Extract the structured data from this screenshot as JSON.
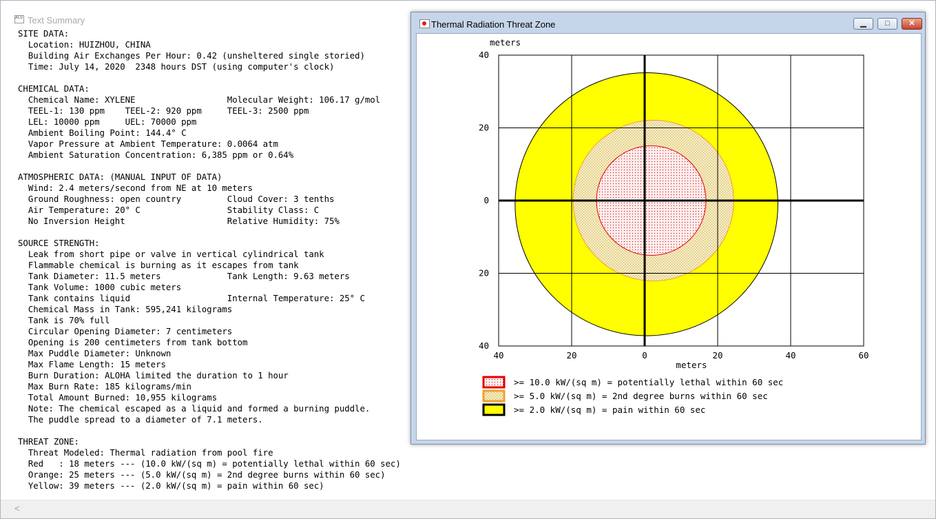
{
  "summary_window": {
    "title": "Text Summary",
    "lines": [
      "SITE DATA:",
      "  Location: HUIZHOU, CHINA",
      "  Building Air Exchanges Per Hour: 0.42 (unsheltered single storied)",
      "  Time: July 14, 2020  2348 hours DST (using computer's clock)",
      "",
      "CHEMICAL DATA:",
      "  Chemical Name: XYLENE                  Molecular Weight: 106.17 g/mol",
      "  TEEL-1: 130 ppm    TEEL-2: 920 ppm     TEEL-3: 2500 ppm",
      "  LEL: 10000 ppm     UEL: 70000 ppm",
      "  Ambient Boiling Point: 144.4° C",
      "  Vapor Pressure at Ambient Temperature: 0.0064 atm",
      "  Ambient Saturation Concentration: 6,385 ppm or 0.64%",
      "",
      "ATMOSPHERIC DATA: (MANUAL INPUT OF DATA)",
      "  Wind: 2.4 meters/second from NE at 10 meters",
      "  Ground Roughness: open country         Cloud Cover: 3 tenths",
      "  Air Temperature: 20° C                 Stability Class: C",
      "  No Inversion Height                    Relative Humidity: 75%",
      "",
      "SOURCE STRENGTH:",
      "  Leak from short pipe or valve in vertical cylindrical tank",
      "  Flammable chemical is burning as it escapes from tank",
      "  Tank Diameter: 11.5 meters             Tank Length: 9.63 meters",
      "  Tank Volume: 1000 cubic meters",
      "  Tank contains liquid                   Internal Temperature: 25° C",
      "  Chemical Mass in Tank: 595,241 kilograms",
      "  Tank is 70% full",
      "  Circular Opening Diameter: 7 centimeters",
      "  Opening is 200 centimeters from tank bottom",
      "  Max Puddle Diameter: Unknown",
      "  Max Flame Length: 15 meters",
      "  Burn Duration: ALOHA limited the duration to 1 hour",
      "  Max Burn Rate: 185 kilograms/min",
      "  Total Amount Burned: 10,955 kilograms",
      "  Note: The chemical escaped as a liquid and formed a burning puddle.",
      "  The puddle spread to a diameter of 7.1 meters.",
      "",
      "THREAT ZONE:",
      "  Threat Modeled: Thermal radiation from pool fire",
      "  Red   : 18 meters --- (10.0 kW/(sq m) = potentially lethal within 60 sec)",
      "  Orange: 25 meters --- (5.0 kW/(sq m) = 2nd degree burns within 60 sec)",
      "  Yellow: 39 meters --- (2.0 kW/(sq m) = pain within 60 sec)"
    ],
    "scroll_left_glyph": "<"
  },
  "threat_window": {
    "title": "Thermal Radiation Threat Zone",
    "controls": {
      "minimize": "▁",
      "maximize": "□",
      "close": "✕"
    }
  },
  "chart_data": {
    "type": "area",
    "y_axis_title": "meters",
    "x_axis_title": "meters",
    "x_ticks": [
      "40",
      "20",
      "0",
      "20",
      "40",
      "60"
    ],
    "y_ticks": [
      "40",
      "20",
      "0",
      "20",
      "40"
    ],
    "xlim": [
      -40,
      60
    ],
    "ylim": [
      -40,
      40
    ],
    "grid": true,
    "zones": [
      {
        "name": "red",
        "radius": 15,
        "center": [
          1.8,
          0
        ],
        "fill": "#ffe6e6",
        "stroke": "#e00000",
        "pattern": "dots",
        "legend": ">= 10.0 kW/(sq m) = potentially lethal within 60 sec"
      },
      {
        "name": "orange",
        "radius": 22,
        "center": [
          2.4,
          0
        ],
        "fill": "#efe4b0",
        "stroke": "#f0a02a",
        "pattern": "speckle",
        "legend": ">= 5.0 kW/(sq m) = 2nd degree burns within 60 sec"
      },
      {
        "name": "yellow",
        "radius": 36,
        "center": [
          0.5,
          -1
        ],
        "fill": "#ffff00",
        "stroke": "#000000",
        "pattern": "solid",
        "legend": ">= 2.0 kW/(sq m) = pain within 60 sec"
      }
    ]
  }
}
